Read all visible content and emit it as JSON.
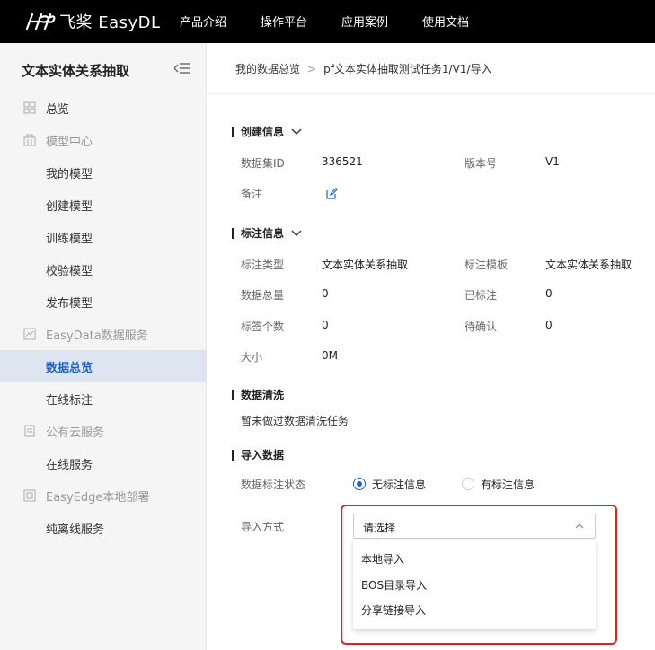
{
  "header": {
    "logo_text": "飞桨 EasyDL",
    "nav": [
      "产品介绍",
      "操作平台",
      "应用案例",
      "使用文档"
    ]
  },
  "sidebar": {
    "title": "文本实体关系抽取",
    "items": [
      {
        "label": "总览",
        "icon": "grid-icon",
        "type": "group"
      },
      {
        "label": "模型中心",
        "icon": "model-icon",
        "type": "group"
      },
      {
        "label": "我的模型",
        "type": "sub"
      },
      {
        "label": "创建模型",
        "type": "sub"
      },
      {
        "label": "训练模型",
        "type": "sub"
      },
      {
        "label": "校验模型",
        "type": "sub"
      },
      {
        "label": "发布模型",
        "type": "sub"
      },
      {
        "label": "EasyData数据服务",
        "icon": "chart-icon",
        "type": "group"
      },
      {
        "label": "数据总览",
        "type": "sub",
        "active": true
      },
      {
        "label": "在线标注",
        "type": "sub"
      },
      {
        "label": "公有云服务",
        "icon": "cloud-icon",
        "type": "group"
      },
      {
        "label": "在线服务",
        "type": "sub"
      },
      {
        "label": "EasyEdge本地部署",
        "icon": "edge-icon",
        "type": "group"
      },
      {
        "label": "纯离线服务",
        "type": "sub"
      }
    ]
  },
  "breadcrumb": {
    "root": "我的数据总览",
    "separator": ">",
    "current": "pf文本实体抽取测试任务1/V1/导入"
  },
  "create_info": {
    "title": "创建信息",
    "dataset_id_label": "数据集ID",
    "dataset_id": "336521",
    "version_label": "版本号",
    "version": "V1",
    "remark_label": "备注"
  },
  "annotation_info": {
    "title": "标注信息",
    "type_label": "标注类型",
    "type_value": "文本实体关系抽取",
    "template_label": "标注模板",
    "template_value": "文本实体关系抽取",
    "total_label": "数据总量",
    "total_value": "0",
    "annotated_label": "已标注",
    "annotated_value": "0",
    "tag_count_label": "标签个数",
    "tag_count_value": "0",
    "pending_label": "待确认",
    "pending_value": "0",
    "size_label": "大小",
    "size_value": "0M"
  },
  "cleaning": {
    "title": "数据清洗",
    "text": "暂未做过数据清洗任务"
  },
  "import": {
    "title": "导入数据",
    "status_label": "数据标注状态",
    "option_none": "无标注信息",
    "option_has": "有标注信息",
    "method_label": "导入方式",
    "select_placeholder": "请选择",
    "options": [
      "本地导入",
      "BOS目录导入",
      "分享链接导入"
    ]
  },
  "colors": {
    "accent": "#1f62c7",
    "highlight": "#e02020",
    "topbar": "#000000"
  }
}
